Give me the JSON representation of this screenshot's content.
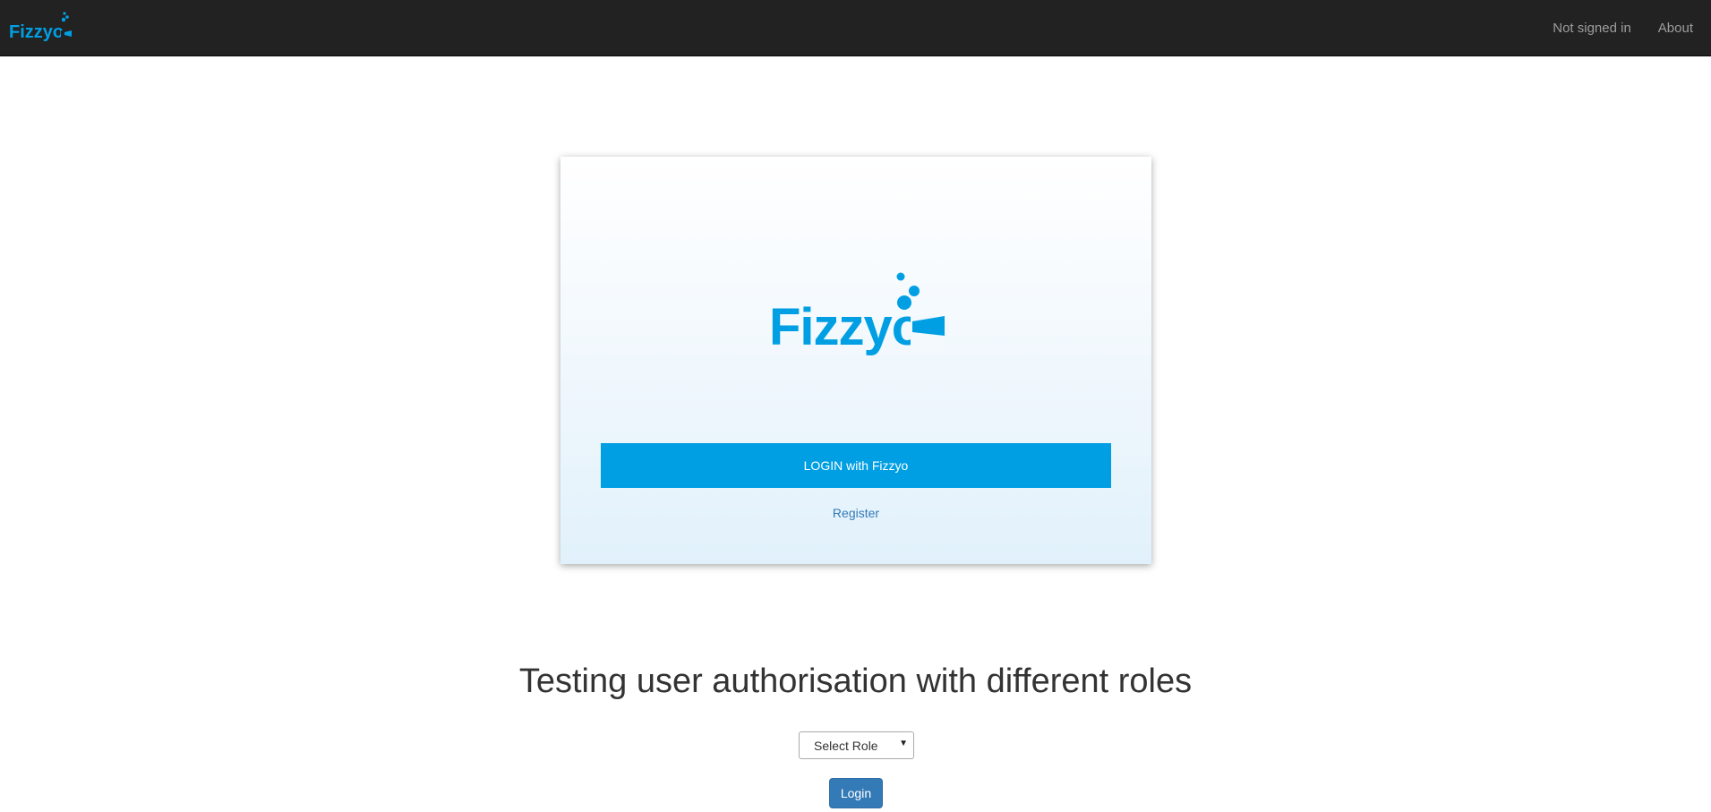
{
  "navbar": {
    "brand_text": "Fizzyo",
    "links": [
      "Not signed in",
      "About"
    ]
  },
  "card": {
    "logo_text": "Fizzyo",
    "login_button_label": "LOGIN with Fizzyo",
    "register_label": "Register"
  },
  "main": {
    "heading": "Testing user authorisation with different roles",
    "role_select_value": "Select Role",
    "login_button_label": "Login"
  },
  "colors": {
    "brand": "#009fe3",
    "navbar_bg": "#222222",
    "primary_button": "#337ab7"
  }
}
